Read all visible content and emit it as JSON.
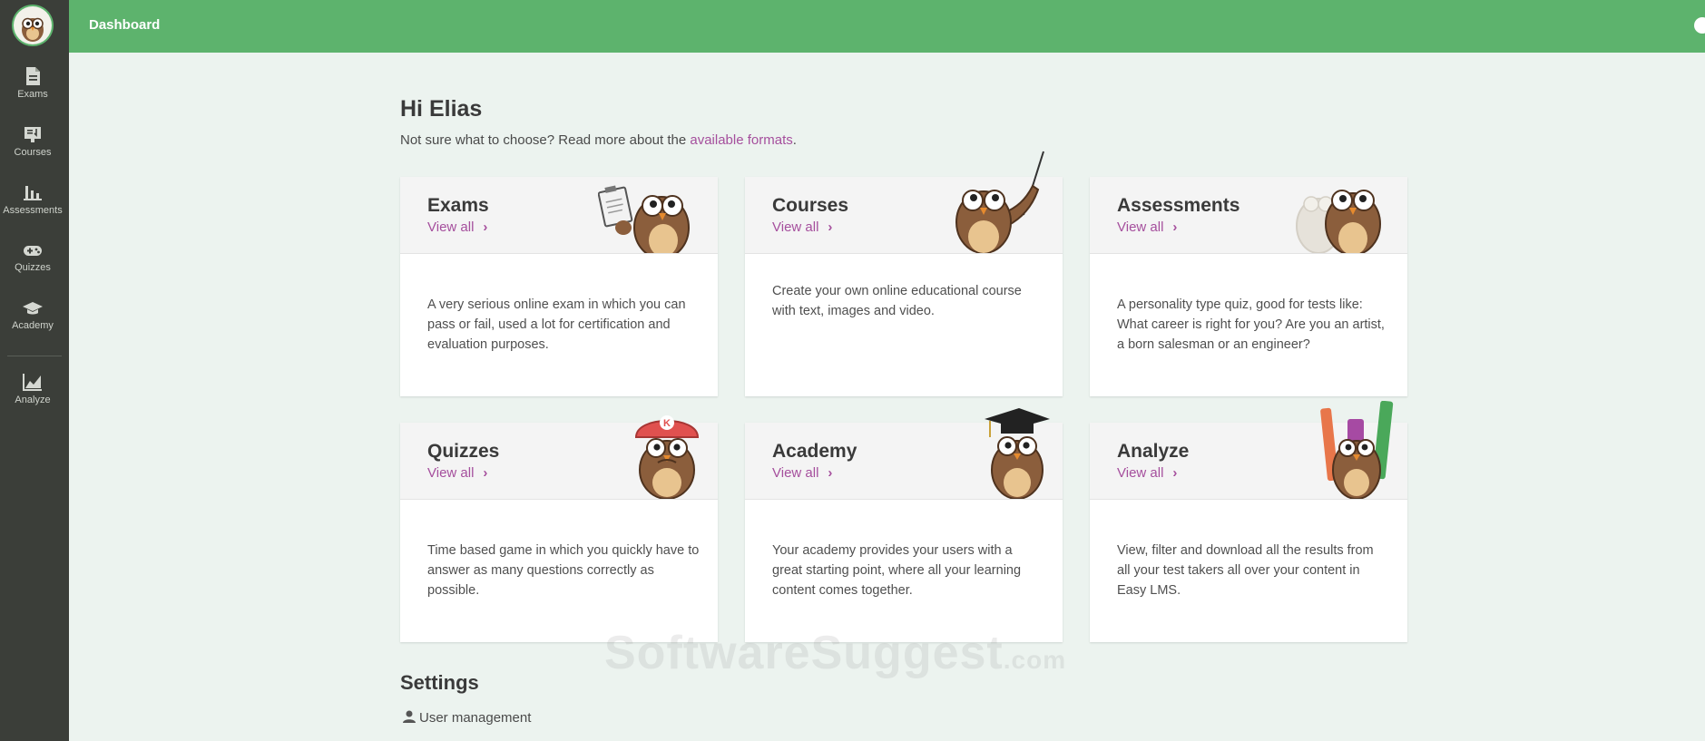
{
  "topbar": {
    "title": "Dashboard"
  },
  "sidebar": {
    "items": [
      {
        "label": "Exams",
        "icon": "document-icon"
      },
      {
        "label": "Courses",
        "icon": "courses-icon"
      },
      {
        "label": "Assessments",
        "icon": "bar-chart-icon"
      },
      {
        "label": "Quizzes",
        "icon": "gamepad-icon"
      },
      {
        "label": "Academy",
        "icon": "graduation-cap-icon"
      },
      {
        "label": "Analyze",
        "icon": "line-chart-icon"
      }
    ]
  },
  "main": {
    "greeting": "Hi Elias",
    "intro_text": "Not sure what to choose? Read more about the ",
    "intro_link": "available formats",
    "intro_end": "."
  },
  "cards": [
    {
      "title": "Exams",
      "link": "View all",
      "description": "A very serious online exam in which you can pass or fail, used a lot for certification and evaluation purposes."
    },
    {
      "title": "Courses",
      "link": "View all",
      "description": "Create your own online educational course with text, images and video."
    },
    {
      "title": "Assessments",
      "link": "View all",
      "description": "A personality type quiz, good for tests like: What career is right for you? Are you an artist, a born salesman or an engineer?"
    },
    {
      "title": "Quizzes",
      "link": "View all",
      "description": "Time based game in which you quickly have to answer as many questions correctly as possible."
    },
    {
      "title": "Academy",
      "link": "View all",
      "description": "Your academy provides your users with a great starting point, where all your learning content comes together."
    },
    {
      "title": "Analyze",
      "link": "View all",
      "description": "View, filter and download all the results from all your test takers all over your content in Easy LMS."
    }
  ],
  "settings": {
    "title": "Settings",
    "user_management": "User management"
  },
  "watermark": {
    "main": "SoftwareSuggest",
    "suffix": ".com"
  },
  "colors": {
    "topbar": "#5db36d",
    "sidebar": "#3b3e39",
    "link": "#a54f9d",
    "background": "#ecf3ef"
  }
}
